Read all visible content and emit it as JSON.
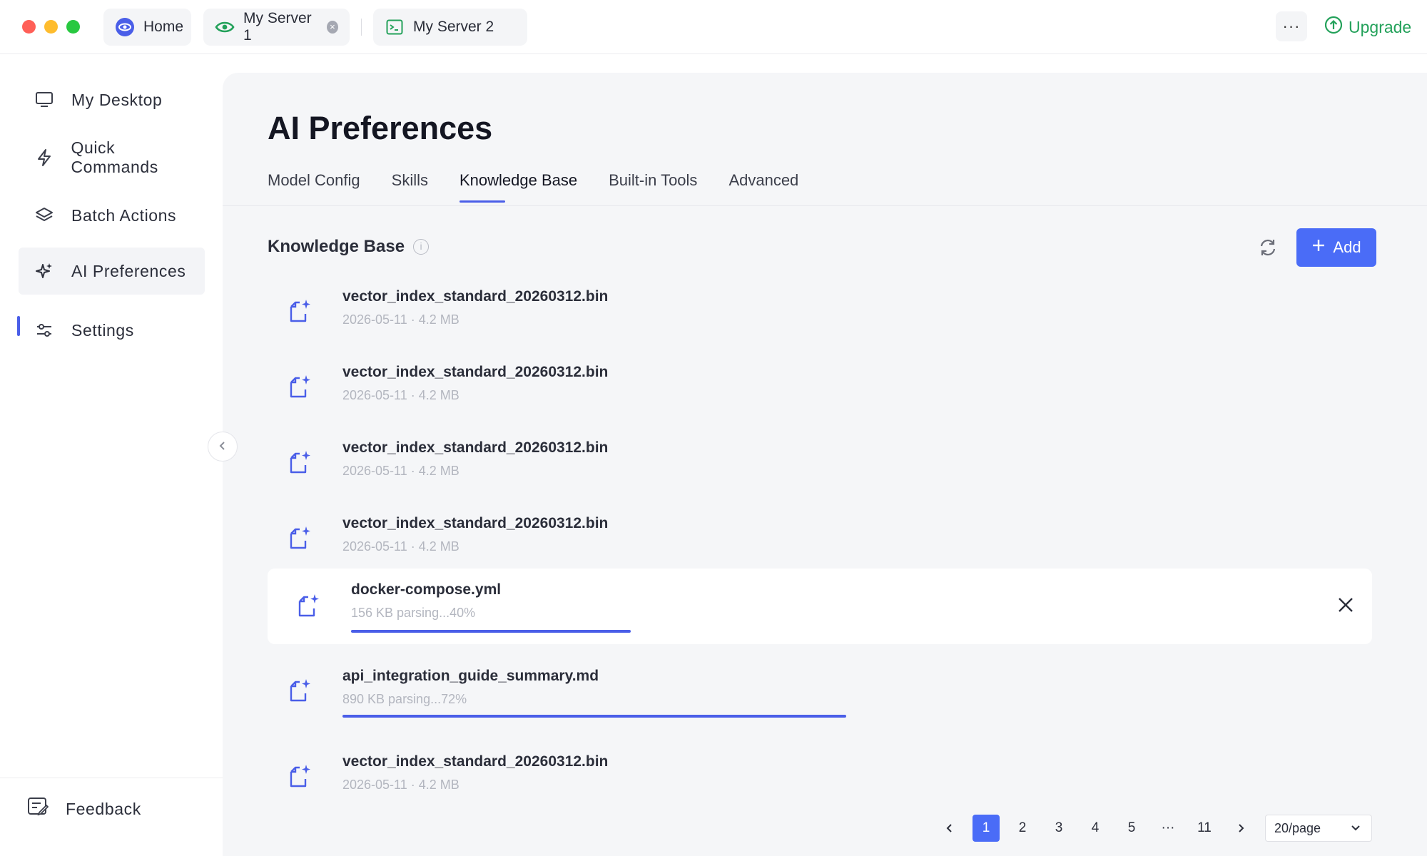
{
  "titlebar": {
    "tabs": [
      {
        "label": "Home"
      },
      {
        "label": "My Server 1"
      },
      {
        "label": "My Server 2"
      }
    ],
    "more_label": "···",
    "upgrade_label": "Upgrade"
  },
  "sidebar": {
    "items": [
      {
        "label": "My Desktop",
        "icon": "monitor-icon"
      },
      {
        "label": "Quick Commands",
        "icon": "lightning-icon"
      },
      {
        "label": "Batch Actions",
        "icon": "layers-icon"
      },
      {
        "label": "AI Preferences",
        "icon": "sparkle-icon",
        "active": true
      },
      {
        "label": "Settings",
        "icon": "sliders-icon"
      }
    ],
    "feedback_label": "Feedback"
  },
  "main": {
    "title": "AI Preferences",
    "tabs": [
      {
        "label": "Model Config"
      },
      {
        "label": "Skills"
      },
      {
        "label": "Knowledge Base",
        "active": true
      },
      {
        "label": "Built-in Tools"
      },
      {
        "label": "Advanced"
      }
    ],
    "section_title": "Knowledge Base",
    "add_label": "Add",
    "files": [
      {
        "name": "vector_index_standard_20260312.bin",
        "meta": "2026-05-11 · 4.2 MB"
      },
      {
        "name": "vector_index_standard_20260312.bin",
        "meta": "2026-05-11 · 4.2 MB"
      },
      {
        "name": "vector_index_standard_20260312.bin",
        "meta": "2026-05-11 · 4.2 MB"
      },
      {
        "name": "vector_index_standard_20260312.bin",
        "meta": "2026-05-11 · 4.2 MB"
      },
      {
        "name": "docker-compose.yml",
        "meta": "156 KB parsing...40%",
        "progress": 0.4
      },
      {
        "name": "api_integration_guide_summary.md",
        "meta": "890 KB parsing...72%",
        "progress": 0.72
      },
      {
        "name": "vector_index_standard_20260312.bin",
        "meta": "2026-05-11 · 4.2 MB"
      }
    ],
    "pagination": {
      "pages": [
        "1",
        "2",
        "3",
        "4",
        "5",
        "···",
        "11"
      ],
      "current": "1",
      "page_size": "20/page"
    }
  },
  "colors": {
    "accent": "#4a6cf7",
    "progress": "#4a5ee8",
    "upgrade": "#23a15a"
  }
}
